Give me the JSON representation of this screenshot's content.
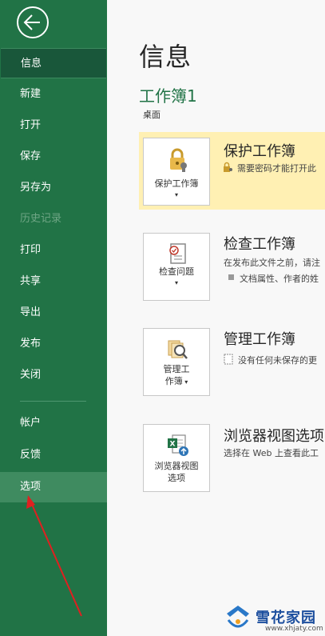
{
  "sidebar": {
    "items": [
      {
        "label": "信息",
        "state": "selected"
      },
      {
        "label": "新建",
        "state": "normal"
      },
      {
        "label": "打开",
        "state": "normal"
      },
      {
        "label": "保存",
        "state": "normal"
      },
      {
        "label": "另存为",
        "state": "normal"
      },
      {
        "label": "历史记录",
        "state": "disabled"
      },
      {
        "label": "打印",
        "state": "normal"
      },
      {
        "label": "共享",
        "state": "normal"
      },
      {
        "label": "导出",
        "state": "normal"
      },
      {
        "label": "发布",
        "state": "normal"
      },
      {
        "label": "关闭",
        "state": "normal"
      },
      {
        "label": "帐户",
        "state": "normal"
      },
      {
        "label": "反馈",
        "state": "normal"
      },
      {
        "label": "选项",
        "state": "hover"
      }
    ],
    "color": "#217346"
  },
  "main": {
    "title": "信息",
    "workbook_name": "工作簿1",
    "location": "桌面",
    "sections": [
      {
        "tile_label": "保护工作簿",
        "title": "保护工作簿",
        "desc": "需要密码才能打开此"
      },
      {
        "tile_label": "检查问题",
        "title": "检查工作簿",
        "desc": "在发布此文件之前，请注",
        "bullet": "文档属性、作者的姓"
      },
      {
        "tile_label_1": "管理工",
        "tile_label_2": "作簿",
        "title": "管理工作簿",
        "desc": "没有任何未保存的更"
      },
      {
        "tile_label_1": "浏览器视图",
        "tile_label_2": "选项",
        "title": "浏览器视图选项",
        "desc": "选择在 Web 上查看此工"
      }
    ]
  },
  "watermark": {
    "name": "雪花家园",
    "url": "www.xhjaty.com"
  },
  "annotation": {
    "color": "#e02020"
  }
}
